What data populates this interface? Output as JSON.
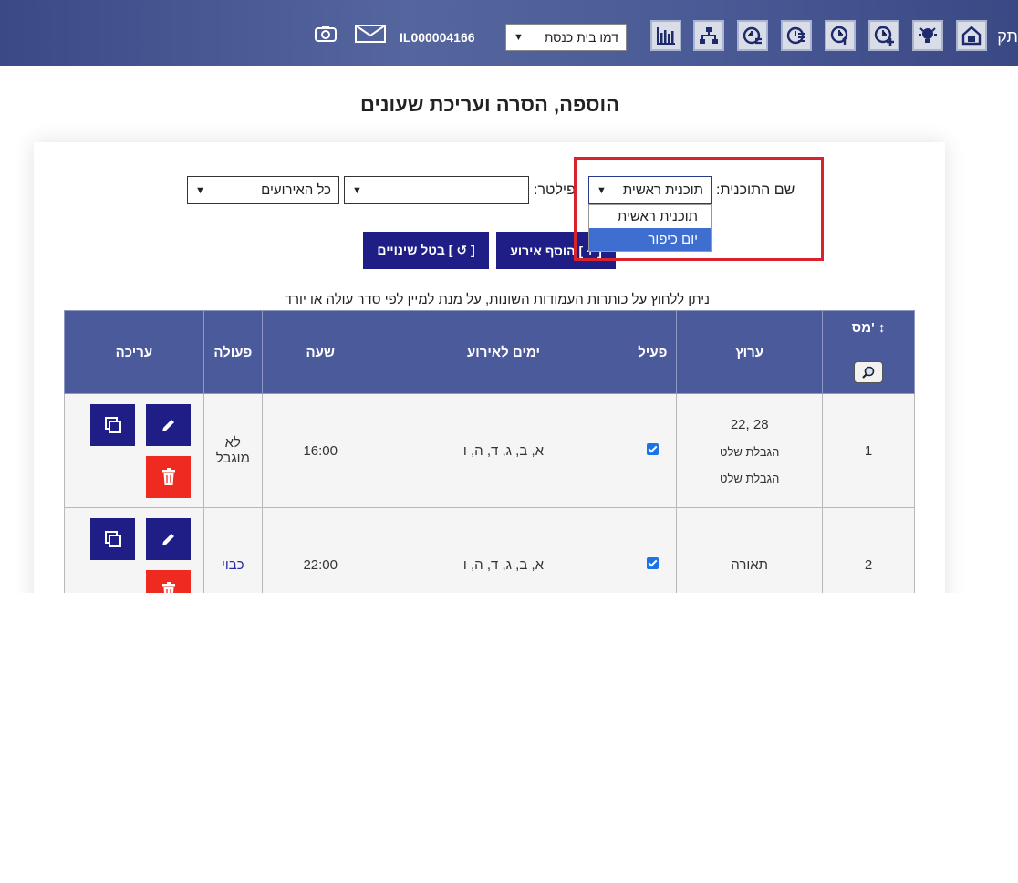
{
  "header": {
    "edge_text": "תק",
    "user_id": "IL000004166",
    "environment_select": "דמו בית כנסת",
    "toolbar_icons": [
      "home-icon",
      "lightbulb-icon",
      "add-clock-icon",
      "clock-plus-one-icon",
      "clock-list-icon",
      "clock-settings-icon",
      "sitemap-icon",
      "bar-chart-icon"
    ],
    "mail_icon": "mail-icon",
    "camera_icon": "camera-icon"
  },
  "page": {
    "title": "הוספה, הסרה ועריכת שעונים"
  },
  "filters": {
    "program_label": "שם התוכנית:",
    "program_selected": "תוכנית ראשית",
    "program_options": [
      "תוכנית ראשית",
      "יום כיפור"
    ],
    "program_highlighted": "יום כיפור",
    "filter_label": "פילטר:",
    "filter_value": "",
    "events_selected": "כל האירועים"
  },
  "actions": {
    "add_event": "[ + ] הוסף אירוע",
    "cancel_changes": "[ ↺ ] בטל שינויים"
  },
  "hint": "ניתן ללחוץ על כותרות העמודות השונות, על מנת למיין לפי סדר עולה או יורד",
  "table": {
    "headers": {
      "num": "מס' ↕",
      "channel": "ערוץ",
      "active": "פעיל",
      "days": "ימים לאירוע",
      "time": "שעה",
      "action": "פעולה",
      "edit": "עריכה"
    },
    "rows": [
      {
        "num": "1",
        "channel_line1": "22, 28",
        "channel_line2": "הגבלת שלט",
        "channel_line3": "הגבלת שלט",
        "active": true,
        "days": "א, ב, ג, ד, ה, ו",
        "time": "16:00",
        "action": "לא מוגבל"
      },
      {
        "num": "2",
        "channel_line1": "תאורה",
        "active": true,
        "days": "א, ב, ג, ד, ה, ו",
        "time": "22:00",
        "action": "כבוי"
      }
    ]
  },
  "colors": {
    "header_bg": "#4b5a9b",
    "button_bg": "#1e1e86",
    "delete_bg": "#ef2a20",
    "highlight_border": "#d8232f"
  }
}
